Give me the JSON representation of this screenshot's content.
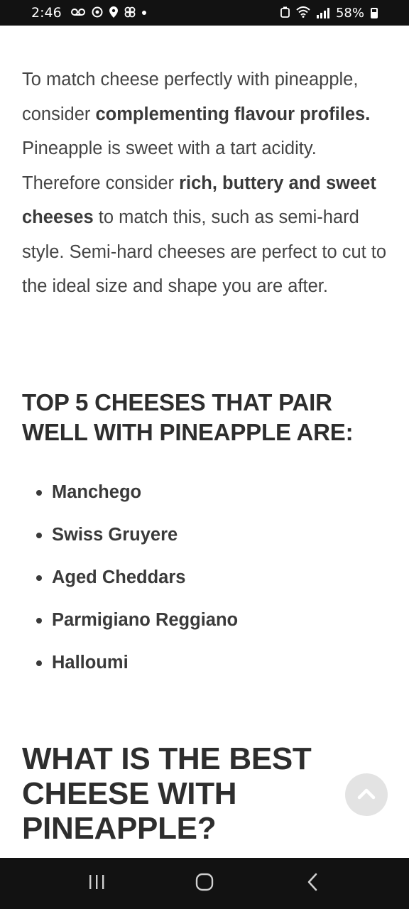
{
  "status_bar": {
    "time": "2:46",
    "battery": "58%",
    "icons": [
      "voicemail-icon",
      "sync-icon",
      "location-icon",
      "fan-icon",
      "notification-dot",
      "alarm-icon",
      "wifi-icon",
      "signal-icon",
      "battery-icon"
    ]
  },
  "article": {
    "intro": {
      "p1": "To match cheese perfectly with pineapple, consider ",
      "b1": "complementing flavour profiles.",
      "p2": " Pineapple is sweet with a tart acidity. Therefore consider ",
      "b2": "rich, buttery and sweet cheeses",
      "p3": " to match this, such as semi-hard style. Semi-hard cheeses are perfect to cut to the ideal size and shape you are after."
    },
    "top5_heading": "TOP 5 CHEESES THAT PAIR WELL WITH PINEAPPLE ARE:",
    "cheeses": [
      "Manchego",
      "Swiss Gruyere",
      "Aged Cheddars",
      "Parmigiano Reggiano",
      "Halloumi"
    ],
    "best_heading": "WHAT IS THE BEST CHEESE WITH PINEAPPLE?"
  },
  "scroll_top": {
    "icon": "chevron-up-icon"
  },
  "nav_bar": {
    "icons": [
      "recent-apps-icon",
      "home-icon",
      "back-icon"
    ]
  },
  "colors": {
    "status_bg": "#121212",
    "text": "#444444",
    "heading": "#2e2e2e",
    "scroll_btn": "#e3e3e3"
  }
}
